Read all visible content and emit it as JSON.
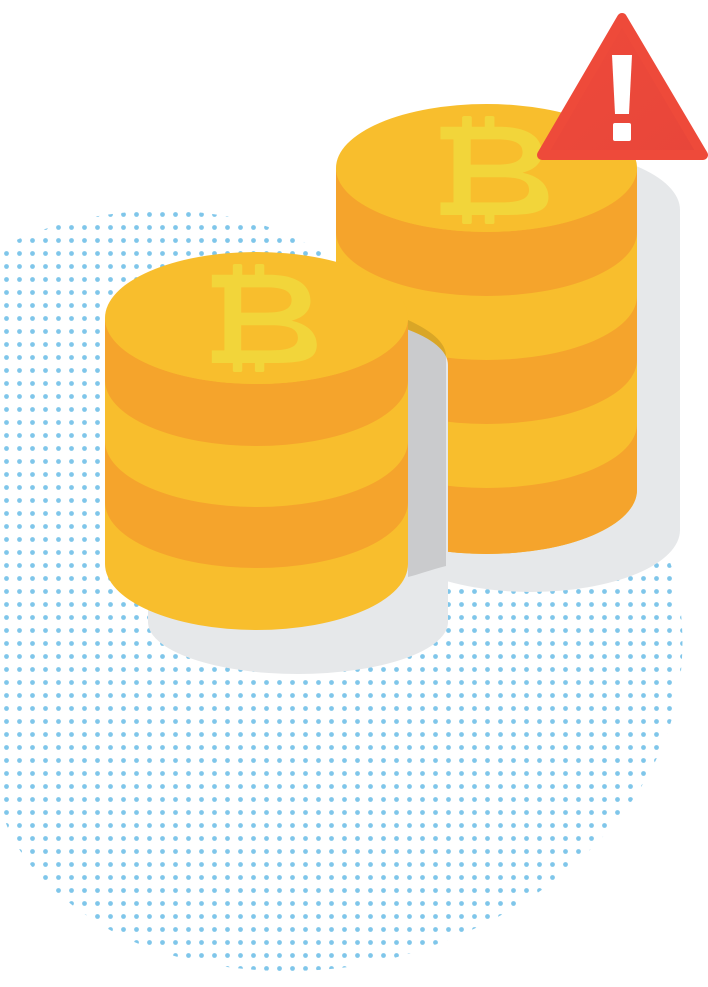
{
  "illustration": {
    "subject": "bitcoin-coin-stacks-with-warning",
    "colors": {
      "background": "#FFFFFF",
      "dots": "#7FC6EA",
      "shadow": "#E6E8EA",
      "shadow_overlay": "#000000",
      "coin_light": "#F8BE2D",
      "coin_dark": "#F5A42C",
      "coin_symbol": "#F2D53A",
      "warning_triangle": "#EE4A3A",
      "warning_mark": "#FFFFFF"
    },
    "icons": {
      "coin_symbol": "bitcoin-icon",
      "warning": "warning-icon"
    },
    "warning": {
      "mark": "!"
    },
    "stacks": [
      {
        "name": "front-stack",
        "coins": 4
      },
      {
        "name": "back-stack",
        "coins": 6
      }
    ]
  }
}
